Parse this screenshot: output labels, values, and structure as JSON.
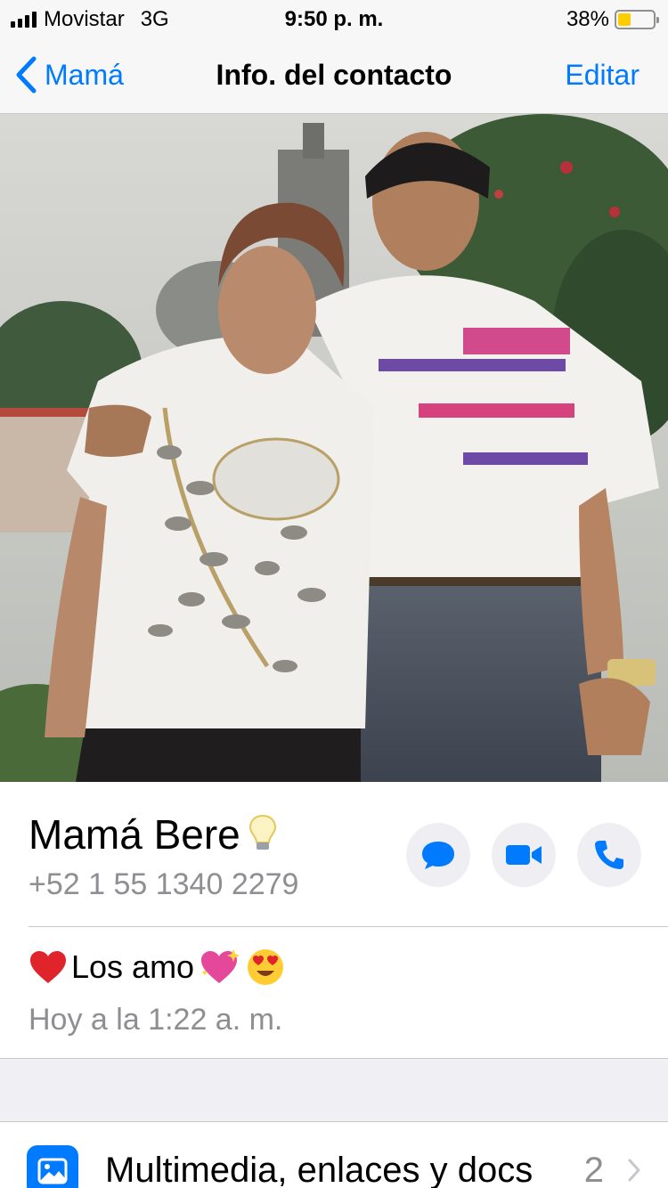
{
  "status_bar": {
    "carrier": "Movistar",
    "network": "3G",
    "time": "9:50 p. m.",
    "battery_percent": "38%",
    "battery_level": 0.38,
    "battery_color": "#ffcc00"
  },
  "nav": {
    "back_label": "Mamá",
    "title": "Info. del contacto",
    "edit_label": "Editar",
    "accent_color": "#007aff"
  },
  "contact": {
    "name": "Mamá Bere",
    "name_emoji": "light-bulb",
    "phone": "+52 1 55 1340 2279",
    "actions": [
      "message-icon",
      "video-call-icon",
      "phone-icon"
    ]
  },
  "about": {
    "text": "Los amo",
    "emojis_before": [
      "red-heart"
    ],
    "emojis_after": [
      "sparkling-heart",
      "heart-eyes-face"
    ],
    "timestamp": "Hoy a la 1:22 a. m."
  },
  "media": {
    "label": "Multimedia, enlaces y docs",
    "count": "2",
    "icon": "photo-icon"
  }
}
